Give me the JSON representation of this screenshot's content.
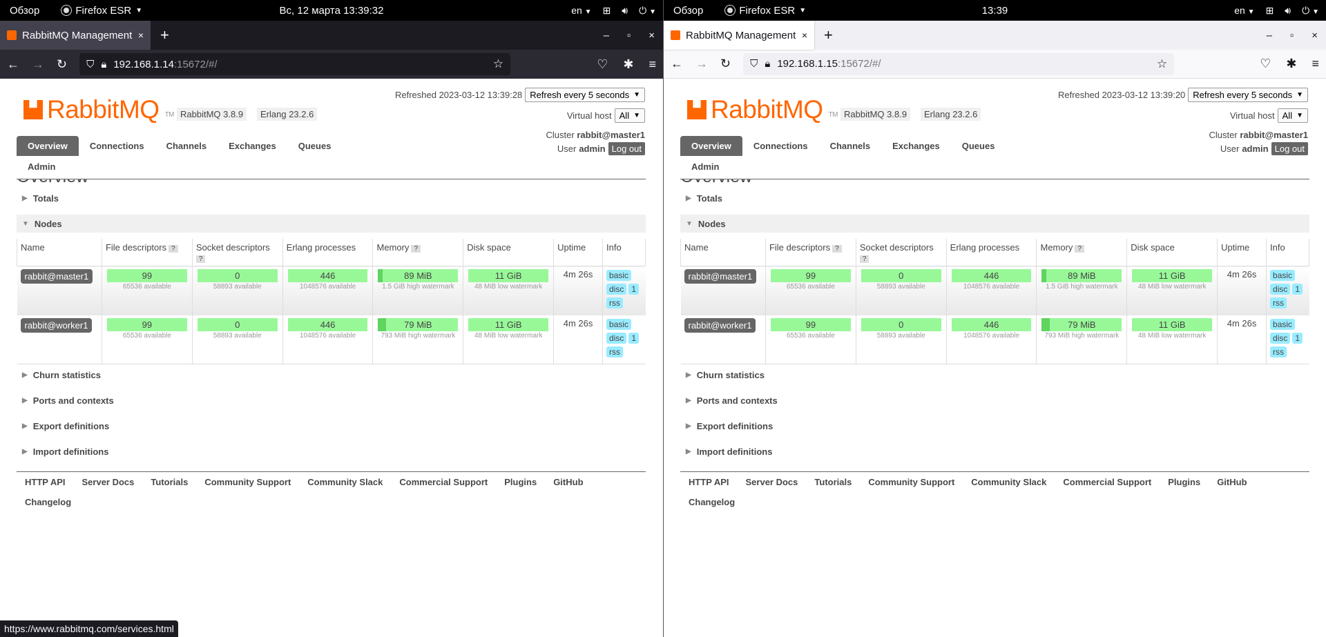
{
  "windows": [
    {
      "theme": "dark",
      "topbar": {
        "overview": "Обзор",
        "app": "Firefox ESR",
        "clock": "Вс, 12 марта  13:39:32",
        "lang": "en"
      },
      "tab": {
        "title": "RabbitMQ Management",
        "close": "×"
      },
      "new_tab": "+",
      "window_controls": {
        "minimize": "–",
        "maximize": "▫",
        "close": "×"
      },
      "url": {
        "host": "192.168.1.14",
        "port": ":15672/#/"
      },
      "page": {
        "logo_text": "RabbitMQ",
        "logo_tm": "TM",
        "rabbit_version": "RabbitMQ 3.8.9",
        "erlang_version": "Erlang 23.2.6",
        "refreshed_label": "Refreshed 2023-03-12 13:39:28",
        "refresh_select": "Refresh every 5 seconds",
        "vhost_label": "Virtual host",
        "vhost_select": "All",
        "cluster_label": "Cluster",
        "cluster_name": "rabbit@master1",
        "user_label": "User",
        "user_name": "admin",
        "logout": "Log out",
        "nav": [
          "Overview",
          "Connections",
          "Channels",
          "Exchanges",
          "Queues"
        ],
        "admin": "Admin",
        "page_title": "Overview",
        "sections_top": [
          "Totals",
          "Nodes"
        ],
        "columns": [
          "Name",
          "File descriptors",
          "Socket descriptors",
          "Erlang processes",
          "Memory",
          "Disk space",
          "Uptime",
          "Info"
        ],
        "help": "?",
        "nodes": [
          {
            "name": "rabbit@master1",
            "fd": "99",
            "fd_sub": "65536 available",
            "sd": "0",
            "sd_sub": "58893 available",
            "ep": "446",
            "ep_sub": "1048576 available",
            "mem": "89 MiB",
            "mem_sub": "1.5 GiB high watermark",
            "mem_fraction": 0.06,
            "disk": "11 GiB",
            "disk_sub": "48 MiB low watermark",
            "uptime": "4m 26s",
            "info": [
              "basic",
              "disc",
              "1",
              "rss"
            ]
          },
          {
            "name": "rabbit@worker1",
            "fd": "99",
            "fd_sub": "65536 available",
            "sd": "0",
            "sd_sub": "58893 available",
            "ep": "446",
            "ep_sub": "1048576 available",
            "mem": "79 MiB",
            "mem_sub": "793 MiB high watermark",
            "mem_fraction": 0.1,
            "disk": "11 GiB",
            "disk_sub": "48 MiB low watermark",
            "uptime": "4m 26s",
            "info": [
              "basic",
              "disc",
              "1",
              "rss"
            ]
          }
        ],
        "sections_bottom": [
          "Churn statistics",
          "Ports and contexts",
          "Export definitions",
          "Import definitions"
        ],
        "footer": [
          "HTTP API",
          "Server Docs",
          "Tutorials",
          "Community Support",
          "Community Slack",
          "Commercial Support",
          "Plugins",
          "GitHub",
          "Changelog"
        ]
      },
      "status_url": "https://www.rabbitmq.com/services.html"
    },
    {
      "theme": "light",
      "topbar": {
        "overview": "Обзор",
        "app": "Firefox ESR",
        "clock": "13:39",
        "lang": "en"
      },
      "tab": {
        "title": "RabbitMQ Management",
        "close": "×"
      },
      "new_tab": "+",
      "window_controls": {
        "minimize": "–",
        "maximize": "▫",
        "close": "×"
      },
      "url": {
        "host": "192.168.1.15",
        "port": ":15672/#/"
      },
      "page": {
        "logo_text": "RabbitMQ",
        "logo_tm": "TM",
        "rabbit_version": "RabbitMQ 3.8.9",
        "erlang_version": "Erlang 23.2.6",
        "refreshed_label": "Refreshed 2023-03-12 13:39:20",
        "refresh_select": "Refresh every 5 seconds",
        "vhost_label": "Virtual host",
        "vhost_select": "All",
        "cluster_label": "Cluster",
        "cluster_name": "rabbit@master1",
        "user_label": "User",
        "user_name": "admin",
        "logout": "Log out",
        "nav": [
          "Overview",
          "Connections",
          "Channels",
          "Exchanges",
          "Queues"
        ],
        "admin": "Admin",
        "page_title": "Overview",
        "sections_top": [
          "Totals",
          "Nodes"
        ],
        "columns": [
          "Name",
          "File descriptors",
          "Socket descriptors",
          "Erlang processes",
          "Memory",
          "Disk space",
          "Uptime",
          "Info"
        ],
        "help": "?",
        "nodes": [
          {
            "name": "rabbit@master1",
            "fd": "99",
            "fd_sub": "65536 available",
            "sd": "0",
            "sd_sub": "58893 available",
            "ep": "446",
            "ep_sub": "1048576 available",
            "mem": "89 MiB",
            "mem_sub": "1.5 GiB high watermark",
            "mem_fraction": 0.06,
            "disk": "11 GiB",
            "disk_sub": "48 MiB low watermark",
            "uptime": "4m 26s",
            "info": [
              "basic",
              "disc",
              "1",
              "rss"
            ]
          },
          {
            "name": "rabbit@worker1",
            "fd": "99",
            "fd_sub": "65536 available",
            "sd": "0",
            "sd_sub": "58893 available",
            "ep": "446",
            "ep_sub": "1048576 available",
            "mem": "79 MiB",
            "mem_sub": "793 MiB high watermark",
            "mem_fraction": 0.1,
            "disk": "11 GiB",
            "disk_sub": "48 MiB low watermark",
            "uptime": "4m 26s",
            "info": [
              "basic",
              "disc",
              "1",
              "rss"
            ]
          }
        ],
        "sections_bottom": [
          "Churn statistics",
          "Ports and contexts",
          "Export definitions",
          "Import definitions"
        ],
        "footer": [
          "HTTP API",
          "Server Docs",
          "Tutorials",
          "Community Support",
          "Community Slack",
          "Commercial Support",
          "Plugins",
          "GitHub",
          "Changelog"
        ]
      },
      "status_url": ""
    }
  ]
}
